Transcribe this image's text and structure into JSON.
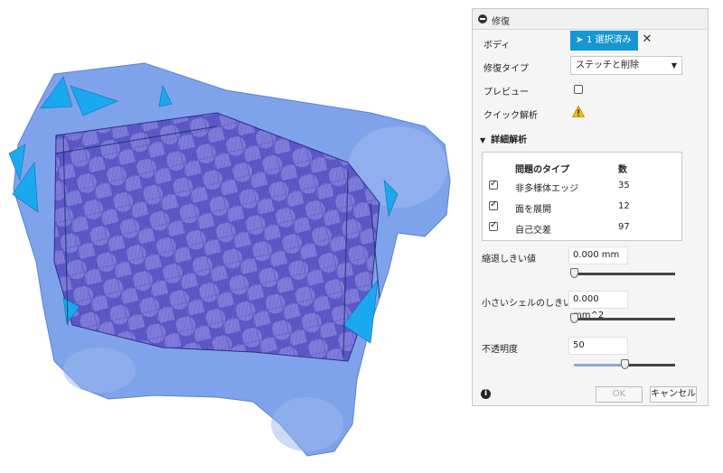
{
  "panel": {
    "title": "修復",
    "body_label": "ボディ",
    "selection_label": "1 選択済み",
    "repair_type_label": "修復タイプ",
    "repair_type_value": "ステッチと削除",
    "preview_label": "プレビュー",
    "quick_analysis_label": "クイック解析",
    "detail_section_label": "詳細解析",
    "table": {
      "col_type": "問題のタイプ",
      "col_count": "数",
      "rows": [
        {
          "type": "非多様体エッジ",
          "count": "35",
          "checked": true
        },
        {
          "type": "面を展開",
          "count": "12",
          "checked": true
        },
        {
          "type": "自己交差",
          "count": "97",
          "checked": true
        }
      ]
    },
    "shrink_label": "縮退しきい値",
    "shrink_value": "0.000 mm",
    "shrink_level": 0.0,
    "small_shell_label": "小さいシェルのしきい値",
    "small_shell_value": "0.000 mm^2",
    "small_shell_level": 0.0,
    "opacity_label": "不透明度",
    "opacity_value": "50",
    "opacity_level": 0.5,
    "ok_label": "OK",
    "cancel_label": "キャンセル"
  },
  "colors": {
    "accent": "#1696d2",
    "mesh_blue": "#7fa3ea",
    "mesh_purple": "#5d58c8",
    "error_cyan": "#1aa9f0",
    "warning": "#f2c200"
  },
  "icons": {
    "collapse": "minus-circle-icon",
    "select_cursor": "cursor-arrow-icon",
    "clear": "close-icon",
    "warning": "warning-triangle-icon",
    "expand": "triangle-down-icon",
    "info": "info-icon"
  }
}
